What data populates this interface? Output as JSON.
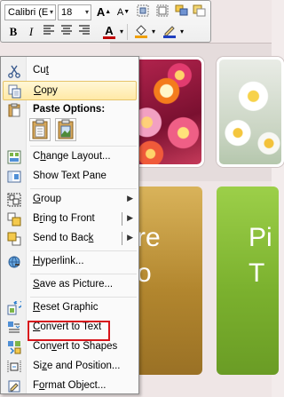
{
  "mini_toolbar": {
    "font_name": "Calibri (E",
    "font_size": "18",
    "grow_font": "A",
    "shrink_font": "A",
    "bold": "B",
    "italic": "I",
    "font_color_glyph": "A",
    "font_color": "#c00000",
    "fill_color": "#f0a000",
    "line_color": "#1f3fbf"
  },
  "menu": {
    "items": [
      {
        "label": "Cut",
        "accel": "t",
        "icon": "scissors-icon"
      },
      {
        "label": "Copy",
        "accel": "C",
        "icon": "copy-icon",
        "highlighted": true
      },
      {
        "label": "Change Layout...",
        "accel": "h",
        "icon": "change-layout-icon"
      },
      {
        "label": "Show Text Pane",
        "accel": "",
        "icon": "text-pane-icon"
      },
      {
        "label": "Group",
        "accel": "G",
        "icon": "group-icon",
        "submenu": true
      },
      {
        "label": "Bring to Front",
        "accel": "r",
        "icon": "bring-front-icon",
        "submenu": true
      },
      {
        "label": "Send to Back",
        "accel": "k",
        "icon": "send-back-icon",
        "submenu": true
      },
      {
        "label": "Hyperlink...",
        "accel": "H",
        "icon": "hyperlink-icon"
      },
      {
        "label": "Save as Picture...",
        "accel": "S",
        "icon": ""
      },
      {
        "label": "Reset Graphic",
        "accel": "R",
        "icon": "reset-graphic-icon"
      },
      {
        "label": "Convert to Text",
        "accel": "C",
        "icon": "convert-text-icon"
      },
      {
        "label": "Convert to Shapes",
        "accel": "v",
        "icon": "convert-shapes-icon"
      },
      {
        "label": "Size and Position...",
        "accel": "z",
        "icon": "size-position-icon"
      },
      {
        "label": "Format Object...",
        "accel": "O",
        "icon": "format-object-icon"
      }
    ],
    "paste_options_label": "Paste Options:"
  },
  "slide": {
    "gold_shape_text": "re\no",
    "green_shape_text": "Pi\nT"
  }
}
